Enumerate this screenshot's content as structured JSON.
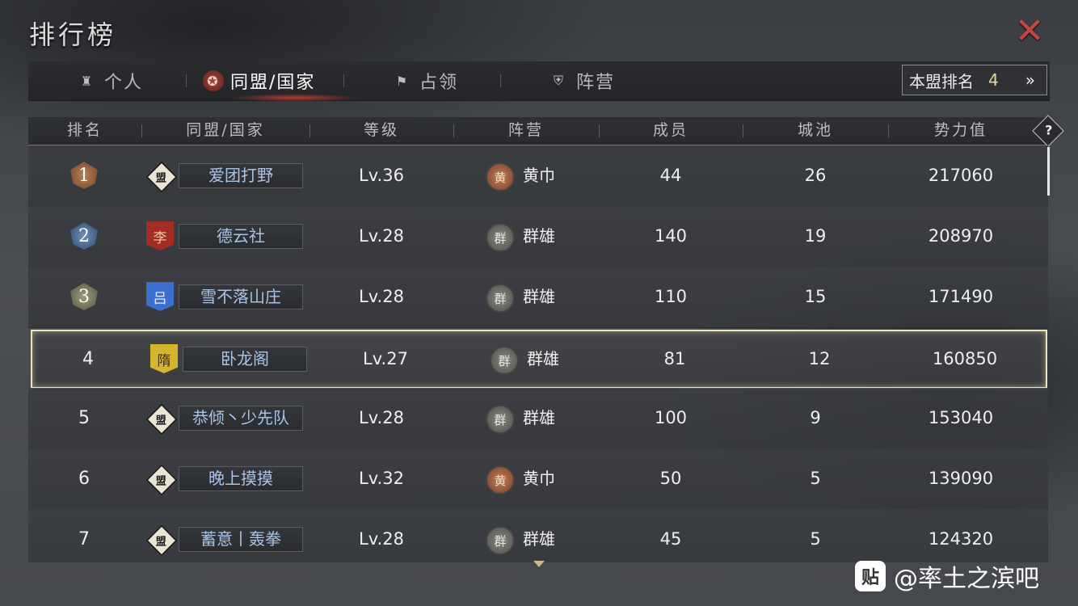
{
  "window": {
    "title": "排行榜",
    "close_icon": "close-icon"
  },
  "tabs": [
    {
      "label": "个人",
      "icon": "person-icon",
      "glyph": "♜",
      "active": false
    },
    {
      "label": "同盟/国家",
      "icon": "alliance-icon",
      "glyph": "✪",
      "active": true
    },
    {
      "label": "占领",
      "icon": "flag-icon",
      "glyph": "⚑",
      "active": false
    },
    {
      "label": "阵营",
      "icon": "faction-icon",
      "glyph": "⛨",
      "active": false
    }
  ],
  "my_rank": {
    "label": "本盟排名",
    "value": "4",
    "arrow": "»"
  },
  "columns": [
    "排名",
    "同盟/国家",
    "等级",
    "阵营",
    "成员",
    "城池",
    "势力值"
  ],
  "help": "?",
  "rows": [
    {
      "rank": "1",
      "flag": "盟",
      "flag_style": "diamond",
      "name": "爱团打野",
      "level": "Lv.36",
      "camp_glyph": "黄",
      "camp_style": "yellow",
      "camp": "黄巾",
      "members": "44",
      "cities": "26",
      "power": "217060"
    },
    {
      "rank": "2",
      "flag": "李",
      "flag_style": "red",
      "name": "德云社",
      "level": "Lv.28",
      "camp_glyph": "群",
      "camp_style": "grey",
      "camp": "群雄",
      "members": "140",
      "cities": "19",
      "power": "208970"
    },
    {
      "rank": "3",
      "flag": "吕",
      "flag_style": "blue",
      "name": "雪不落山庄",
      "level": "Lv.28",
      "camp_glyph": "群",
      "camp_style": "grey",
      "camp": "群雄",
      "members": "110",
      "cities": "15",
      "power": "171490"
    },
    {
      "rank": "4",
      "flag": "隋",
      "flag_style": "yellow",
      "name": "卧龙阁",
      "level": "Lv.27",
      "camp_glyph": "群",
      "camp_style": "grey",
      "camp": "群雄",
      "members": "81",
      "cities": "12",
      "power": "160850"
    },
    {
      "rank": "5",
      "flag": "盟",
      "flag_style": "diamond",
      "name": "恭倾丶少先队",
      "level": "Lv.28",
      "camp_glyph": "群",
      "camp_style": "grey",
      "camp": "群雄",
      "members": "100",
      "cities": "9",
      "power": "153040"
    },
    {
      "rank": "6",
      "flag": "盟",
      "flag_style": "diamond",
      "name": "晚上摸摸",
      "level": "Lv.32",
      "camp_glyph": "黄",
      "camp_style": "yellow",
      "camp": "黄巾",
      "members": "50",
      "cities": "5",
      "power": "139090"
    },
    {
      "rank": "7",
      "flag": "盟",
      "flag_style": "diamond",
      "name": "蓄意丨轰拳",
      "level": "Lv.28",
      "camp_glyph": "群",
      "camp_style": "grey",
      "camp": "群雄",
      "members": "45",
      "cities": "5",
      "power": "124320"
    }
  ],
  "highlight_rank": "4",
  "watermark": {
    "icon_glyph": "贴",
    "text": "@率土之滨吧"
  }
}
